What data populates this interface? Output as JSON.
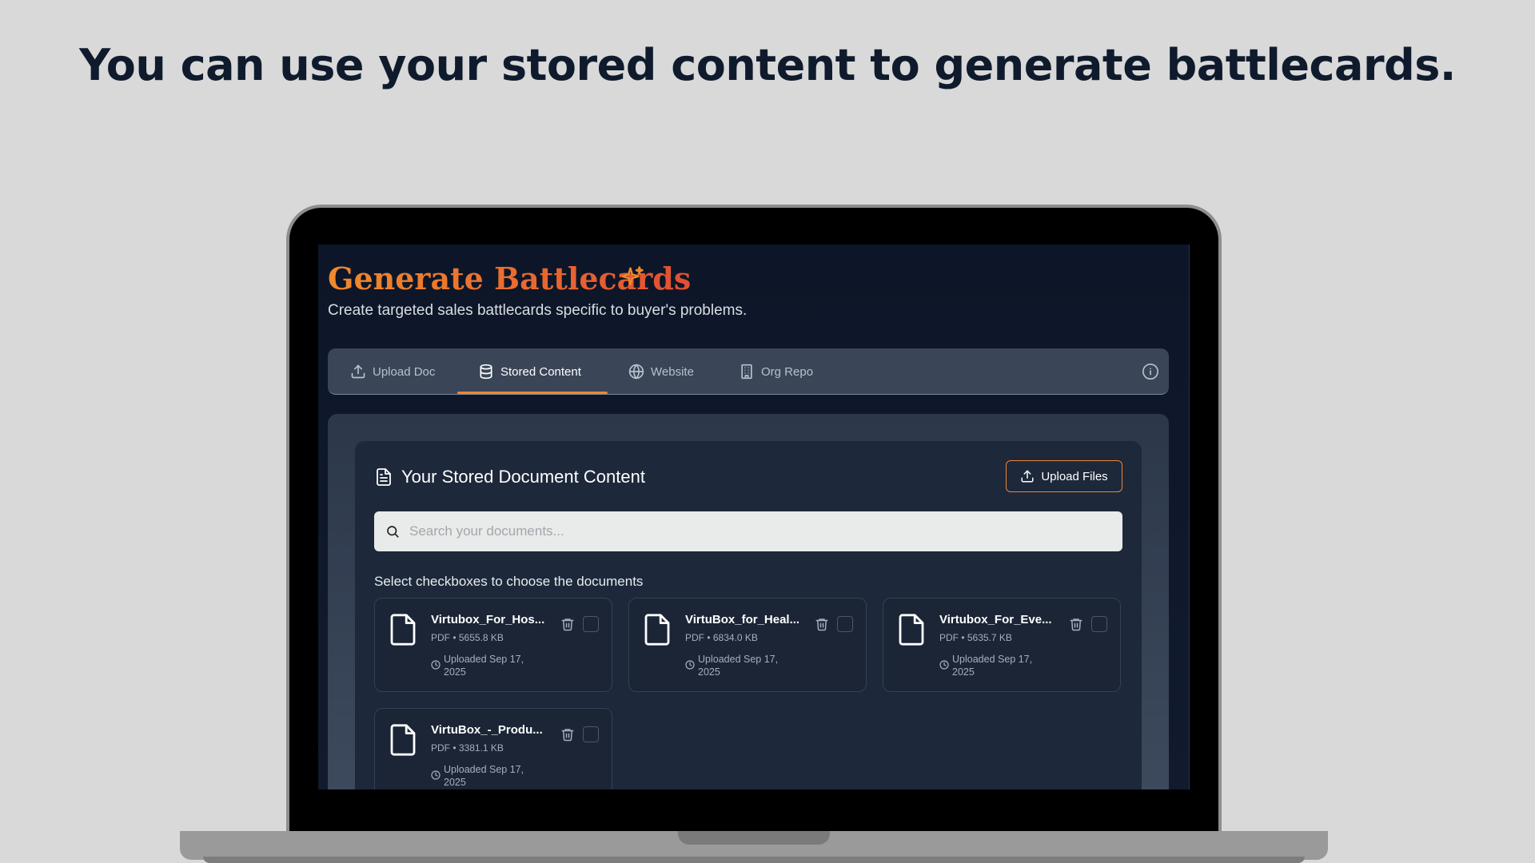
{
  "headline": "You can use your stored content to generate battlecards.",
  "app": {
    "title": "Generate Battlecards",
    "subtitle": "Create targeted sales battlecards specific to buyer's problems."
  },
  "tabs": [
    {
      "label": "Upload Doc",
      "icon": "upload-icon"
    },
    {
      "label": "Stored Content",
      "icon": "database-icon",
      "active": true
    },
    {
      "label": "Website",
      "icon": "globe-icon"
    },
    {
      "label": "Org Repo",
      "icon": "building-icon"
    }
  ],
  "stored": {
    "title": "Your Stored Document Content",
    "upload_label": "Upload Files",
    "search_placeholder": "Search your documents...",
    "hint": "Select checkboxes to choose the documents",
    "documents": [
      {
        "name": "Virtubox_For_Hos...",
        "meta": "PDF • 5655.8 KB",
        "date": "Uploaded Sep 17, 2025"
      },
      {
        "name": "VirtuBox_for_Heal...",
        "meta": "PDF • 6834.0 KB",
        "date": "Uploaded Sep 17, 2025"
      },
      {
        "name": "Virtubox_For_Eve...",
        "meta": "PDF • 5635.7 KB",
        "date": "Uploaded Sep 17, 2025"
      },
      {
        "name": "VirtuBox_-_Produ...",
        "meta": "PDF • 3381.1 KB",
        "date": "Uploaded Sep 17, 2025"
      }
    ]
  },
  "colors": {
    "accent": "#f0862c",
    "title_gradient_start": "#f08a2c",
    "title_gradient_end": "#e24f33",
    "headline": "#0f1b2d"
  }
}
